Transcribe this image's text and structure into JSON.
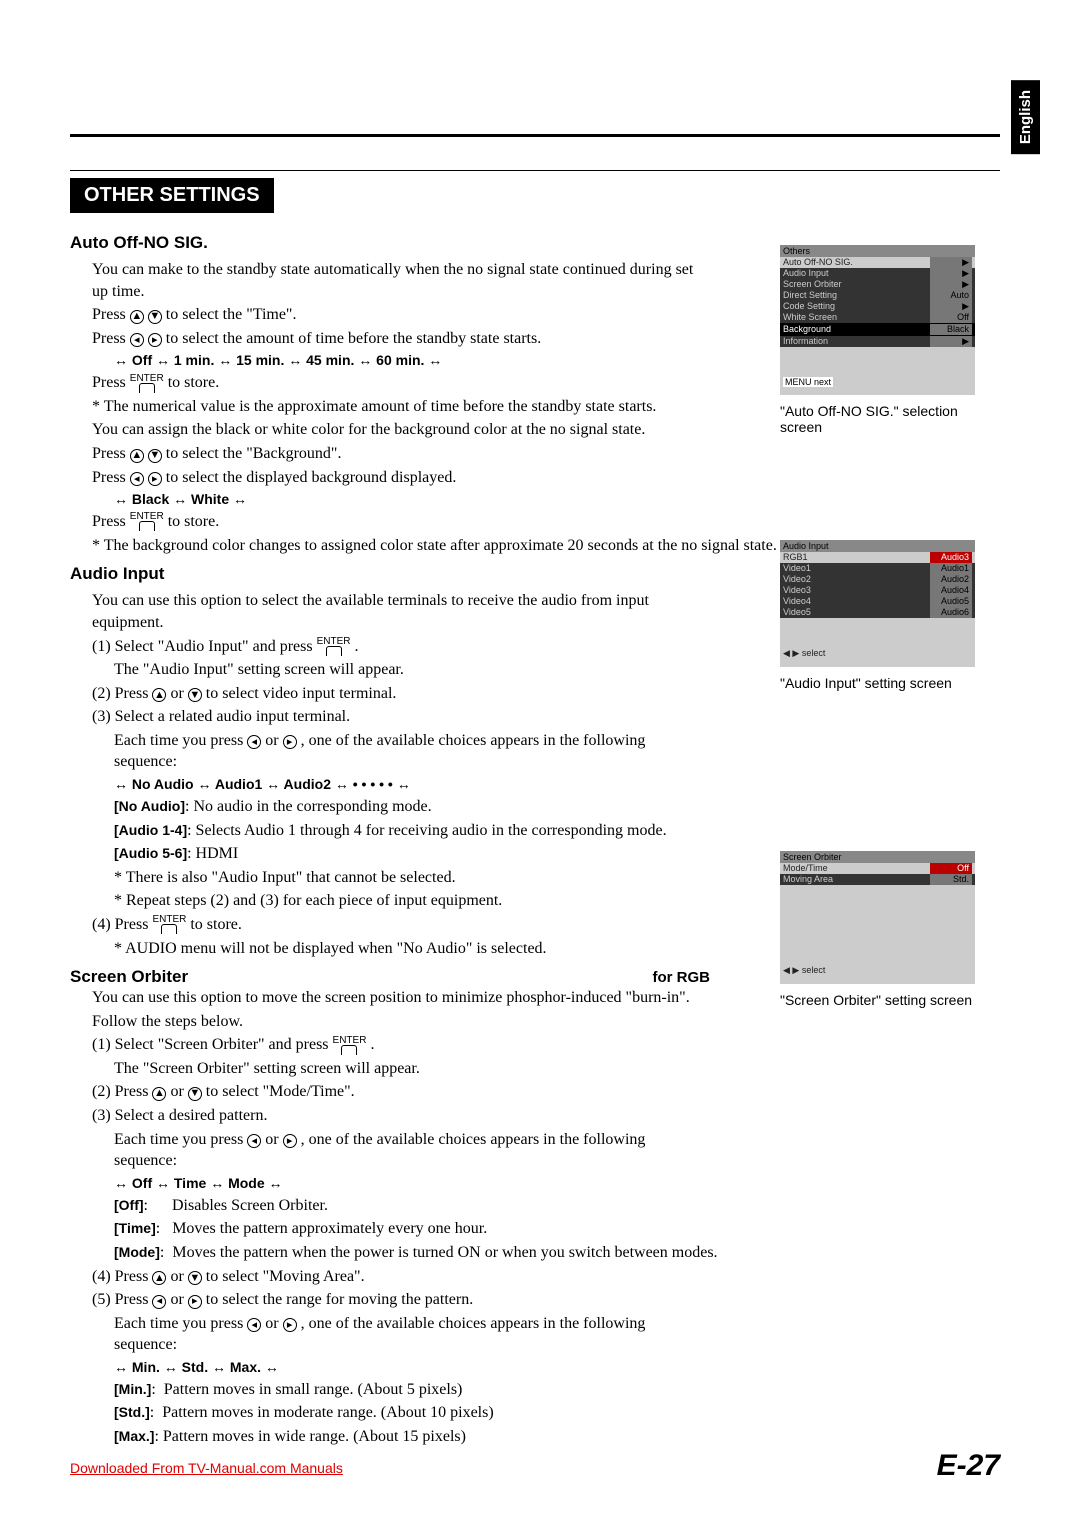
{
  "lang_tab": "English",
  "section_title": "OTHER SETTINGS",
  "auto_off": {
    "heading": "Auto Off-NO SIG.",
    "p1": "You can make to the standby state automatically when the no signal state continued during set up time.",
    "p2_a": "Press ",
    "p2_b": " to select the \"Time\".",
    "p3_a": "Press ",
    "p3_b": " to select the amount of time before the standby state starts.",
    "opts1": "↔ Off ↔ 1 min. ↔ 15 min. ↔ 45 min. ↔ 60 min. ↔",
    "p4_a": "Press ",
    "p4_b": " to store.",
    "p5": "* The numerical value is the approximate amount of time before the standby state starts.",
    "p6": "You can assign the black or white color for the background color at the no signal state.",
    "p7_a": "Press ",
    "p7_b": " to select the \"Background\".",
    "p8_a": "Press ",
    "p8_b": " to select the displayed background displayed.",
    "opts2": "↔ Black ↔ White ↔",
    "p9_a": "Press ",
    "p9_b": " to store.",
    "p10": "* The background color changes to assigned color state after approximate 20 seconds at the no signal state."
  },
  "audio": {
    "heading": "Audio Input",
    "p1": "You can use this option to select the available terminals to receive the audio from input equipment.",
    "s1_a": "(1) Select \"Audio Input\" and press ",
    "s1_b": " .",
    "s1c": "The \"Audio Input\" setting screen will appear.",
    "s2_a": "(2) Press ",
    "s2_b": " or ",
    "s2_c": " to select video input terminal.",
    "s3": "(3) Select a related audio input terminal.",
    "s3b_a": "Each time you press ",
    "s3b_b": " or ",
    "s3b_c": ", one of the available choices appears in the following sequence:",
    "opts": "↔ No Audio ↔ Audio1 ↔ Audio2 ↔ • • • • • ↔",
    "noaud_l": "[No Audio]",
    "noaud_t": ": No audio in the corresponding mode.",
    "a14_l": "[Audio 1-4]",
    "a14_t": ": Selects Audio 1 through 4 for receiving audio in the corresponding mode.",
    "a56_l": "[Audio 5-6]",
    "a56_t": ": HDMI",
    "n1": "* There is also \"Audio Input\" that cannot be selected.",
    "n2": "* Repeat steps (2) and (3) for each piece of input equipment.",
    "s4_a": "(4) Press ",
    "s4_b": " to store.",
    "n3": "* AUDIO menu will not be displayed when \"No Audio\" is selected."
  },
  "orbiter": {
    "heading": "Screen Orbiter",
    "rgb": "for RGB",
    "p1": "You can use this option to move the screen position to minimize phosphor-induced \"burn-in\".",
    "p2": "Follow the steps below.",
    "s1_a": "(1) Select \"Screen Orbiter\" and press ",
    "s1_b": " .",
    "s1c": "The \"Screen Orbiter\" setting screen will appear.",
    "s2_a": "(2) Press ",
    "s2_b": " or ",
    "s2_c": " to select \"Mode/Time\".",
    "s3": "(3) Select a desired pattern.",
    "s3b_a": "Each time you press ",
    "s3b_b": " or ",
    "s3b_c": ", one of the available choices appears in the following sequence:",
    "opts1": "↔ Off ↔  Time ↔ Mode ↔",
    "off_l": "[Off]",
    "off_t": ":      Disables Screen Orbiter.",
    "time_l": "[Time]",
    "time_t": ":   Moves the pattern approximately every one hour.",
    "mode_l": "[Mode]",
    "mode_t": ":  Moves the pattern when the power is turned ON or when you switch between modes.",
    "s4_a": "(4) Press ",
    "s4_b": " or ",
    "s4_c": " to select \"Moving Area\".",
    "s5_a": "(5) Press ",
    "s5_b": " or ",
    "s5_c": " to select the range for moving the pattern.",
    "s5d_a": "Each time you press ",
    "s5d_b": " or ",
    "s5d_c": ", one of the available choices appears in the following sequence:",
    "opts2": "↔ Min. ↔ Std. ↔ Max. ↔",
    "min_l": "[Min.]",
    "min_t": ":  Pattern moves in small range. (About 5 pixels)",
    "std_l": "[Std.]",
    "std_t": ":  Pattern moves in moderate range. (About 10 pixels)",
    "max_l": "[Max.]",
    "max_t": ": Pattern moves in wide range. (About 15 pixels)"
  },
  "shot1": {
    "title": "Others",
    "r0": "Auto Off-NO SIG.",
    "r1": "Audio Input",
    "r2": "Screen Orbiter",
    "r3": "Direct Setting",
    "v3": "Auto",
    "r4": "Code Setting",
    "r5": "White Screen",
    "v5": "Off",
    "r6": "Background",
    "v6": "Black",
    "r7": "Information",
    "foot": "MENU next",
    "caption": "\"Auto Off-NO SIG.\" selection screen"
  },
  "shot2": {
    "title": "Audio Input",
    "r0": "RGB1",
    "v0": "Audio3",
    "r1": "Video1",
    "v1": "Audio1",
    "r2": "Video2",
    "v2": "Audio2",
    "r3": "Video3",
    "v3": "Audio4",
    "r4": "Video4",
    "v4": "Audio5",
    "r5": "Video5",
    "v5": "Audio6",
    "foot": "◀ ▶  select",
    "caption": "\"Audio Input\" setting screen"
  },
  "shot3": {
    "title": "Screen Orbiter",
    "r0": "Mode/Time",
    "v0": "Off",
    "r1": "Moving Area",
    "v1": "Std.",
    "foot": "◀ ▶  select",
    "caption": "\"Screen Orbiter\" setting screen"
  },
  "footer": {
    "link": "Downloaded From TV-Manual.com Manuals",
    "page": "E-27"
  }
}
